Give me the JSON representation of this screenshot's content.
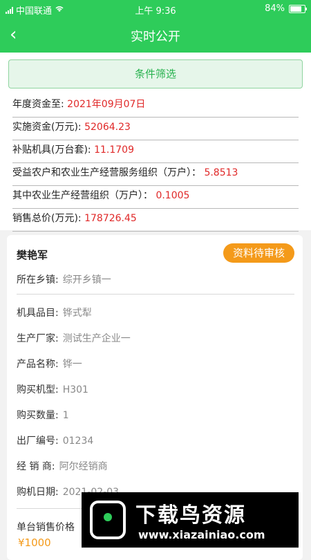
{
  "status_bar": {
    "carrier": "中国联通",
    "time": "上午 9:36",
    "battery": "84%",
    "icons": [
      "signal-icon",
      "wifi-icon",
      "battery-icon"
    ]
  },
  "nav": {
    "back_icon": "‹",
    "title": "实时公开"
  },
  "filter": {
    "label": "条件筛选"
  },
  "summary": [
    {
      "label": "年度资金至:",
      "value": "2021年09月07日"
    },
    {
      "label": "实施资金(万元):",
      "value": "52064.23"
    },
    {
      "label": "补贴机具(万台套):",
      "value": "11.1709"
    },
    {
      "label": "受益农户和农业生产经营服务组织（万户）：",
      "value": "5.8513"
    },
    {
      "label": "其中农业生产经营组织（万户）：",
      "value": "0.1005"
    },
    {
      "label": "销售总价(万元):",
      "value": "178726.45"
    }
  ],
  "record": {
    "name": "樊艳军",
    "status": "资料待审核",
    "status_color": "#f49a1a",
    "fields": [
      {
        "label": "所在乡镇:",
        "value": "综开乡镇一"
      },
      {
        "label": "机具品目:",
        "value": "铧式犁"
      },
      {
        "label": "生产厂家:",
        "value": "测试生产企业一"
      },
      {
        "label": "产品名称:",
        "value": "铧一"
      },
      {
        "label": "购买机型:",
        "value": "H301"
      },
      {
        "label": "购买数量:",
        "value": "1"
      },
      {
        "label": "出厂编号:",
        "value": "01234"
      },
      {
        "label": "经 销 商:",
        "value": "阿尔经销商"
      },
      {
        "label": "购机日期:",
        "value": "2021-02-03"
      }
    ],
    "price_label": "单台销售价格",
    "price_value": "¥1000"
  },
  "watermark": {
    "text": "下载鸟资源",
    "url": "www.xiazainiao.com"
  },
  "colors": {
    "primary": "#2ecc5a",
    "value_red": "#e02828",
    "accent_orange": "#f49a1a"
  }
}
